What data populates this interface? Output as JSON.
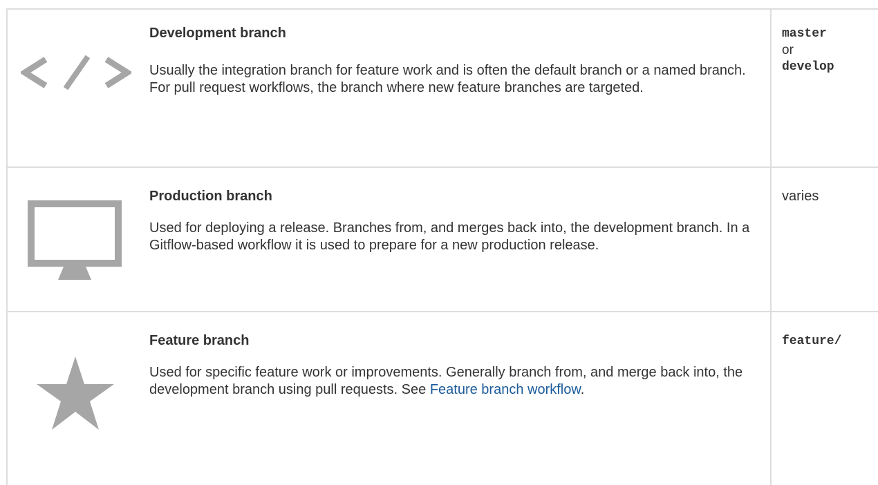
{
  "rows": [
    {
      "icon": "code-icon",
      "title": "Development branch",
      "description": "Usually the integration branch for feature work and is often the default branch or a named branch. For pull request workflows, the branch where new feature branches are targeted.",
      "name_code_1": "master",
      "name_or": "or",
      "name_code_2": "develop"
    },
    {
      "icon": "monitor-icon",
      "title": "Production branch",
      "description": "Used for deploying a release. Branches from, and merges back into, the development branch. In a Gitflow-based workflow it is used to prepare for a new production release.",
      "name_text": "varies"
    },
    {
      "icon": "star-icon",
      "title": "Feature branch",
      "description_text": "Used for specific feature work or improvements. Generally branch from, and merge back into, the development branch using pull requests. See ",
      "description_link": "Feature branch workflow",
      "description_end": ".",
      "name_code_1": "feature/"
    }
  ]
}
